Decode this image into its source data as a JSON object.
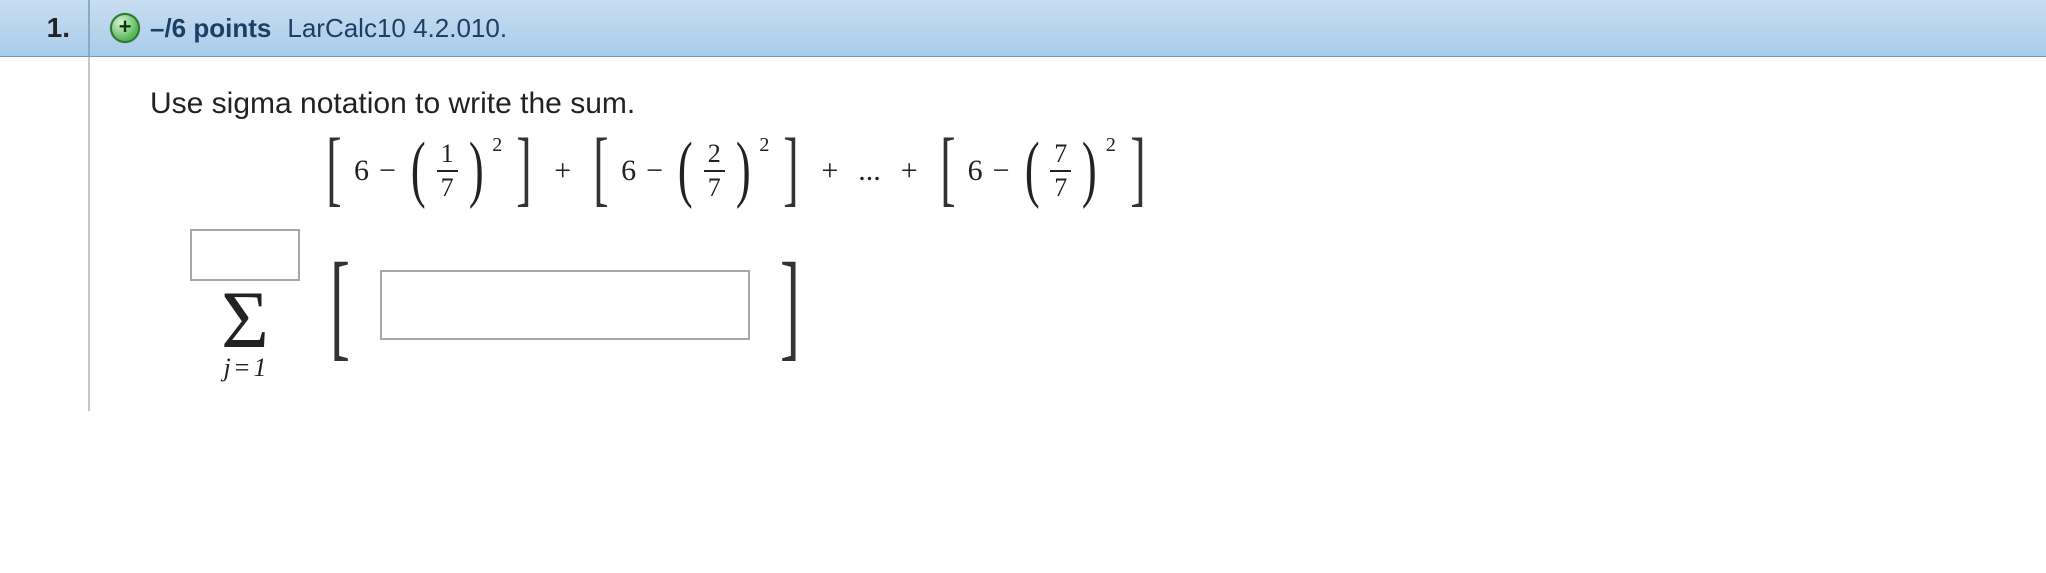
{
  "header": {
    "number": "1.",
    "points": "–/6 points",
    "ref": "LarCalc10 4.2.010."
  },
  "prompt": "Use sigma notation to write the sum.",
  "expr": {
    "base": "6",
    "minus": "−",
    "plus": "+",
    "ellipsis": "...",
    "sq": "2",
    "den": "7",
    "t1num": "1",
    "t2num": "2",
    "t3num": "7"
  },
  "sigma": {
    "symbol": "Σ",
    "index": "j",
    "eq": "=",
    "start": "1"
  }
}
